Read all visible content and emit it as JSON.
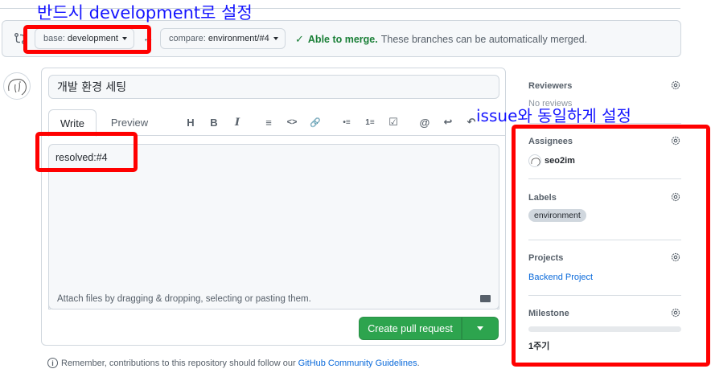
{
  "compare": {
    "base_label": "base:",
    "base_value": "development",
    "compare_label": "compare:",
    "compare_value": "environment/#4",
    "merge_ok": "Able to merge.",
    "merge_text": "These branches can be automatically merged."
  },
  "form": {
    "title_value": "개발 환경 세팅",
    "tabs": [
      "Write",
      "Preview"
    ],
    "toolbar": [
      "H",
      "B",
      "I",
      "≡",
      "<>",
      "🔗",
      "•≡",
      "1≡",
      "☑",
      "@",
      "↩",
      "↶"
    ],
    "body_value": "resolved:#4",
    "attach_text": "Attach files by dragging & dropping, selecting or pasting them.",
    "create_label": "Create pull request"
  },
  "footer": {
    "remember_text": "Remember, contributions to this repository should follow our",
    "guidelines_link": "GitHub Community Guidelines",
    "period": "."
  },
  "sidebar": {
    "reviewers": {
      "heading": "Reviewers",
      "value": "No reviews"
    },
    "assignees": {
      "heading": "Assignees",
      "value": "seo2im"
    },
    "labels": {
      "heading": "Labels",
      "value": "environment"
    },
    "projects": {
      "heading": "Projects",
      "value": "Backend Project"
    },
    "milestone": {
      "heading": "Milestone",
      "value": "1주기",
      "progress": 0
    }
  },
  "annotations": {
    "top": "반드시 development로 설정",
    "right": "issue와 동일하게 설정"
  },
  "colors": {
    "accent_green": "#2da44e",
    "annotation_red": "#ff0000",
    "annotation_blue": "#1515ff",
    "link_blue": "#0969da"
  }
}
